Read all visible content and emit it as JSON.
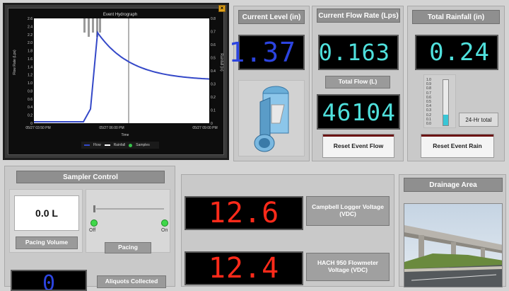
{
  "hydrograph": {
    "title": "Event Hydrograph",
    "y_left_label": "Flow Rate (Lps)",
    "y_right_label": "Rainfall (in)",
    "x_label": "Time",
    "y_left_ticks": [
      "2.6",
      "2.4",
      "2.2",
      "2.0",
      "1.8",
      "1.6",
      "1.4",
      "1.2",
      "1.0",
      "0.8",
      "0.6",
      "0.4",
      "0.2",
      "0"
    ],
    "y_right_ticks": [
      "0.8",
      "0.7",
      "0.6",
      "0.5",
      "0.4",
      "0.3",
      "0.2",
      "0.1",
      "0"
    ],
    "x_ticks": [
      "05/27 03:50 PM",
      "05/27 06:00 PM",
      "05/27 09:00 PM"
    ],
    "legend": [
      "Flow",
      "Rainfall",
      "Samples"
    ],
    "colors": {
      "flow": "#3448c8",
      "rainfall": "#ffffff",
      "samples": "#36c24a"
    },
    "close_icon": "x-icon"
  },
  "current_level": {
    "title": "Current Level (in)",
    "value": "1.37"
  },
  "current_flow": {
    "title": "Current Flow Rate (Lps)",
    "value": "0.163",
    "total_flow_label": "Total Flow (L)",
    "total_flow_value": "46104",
    "reset_label": "Reset Event Flow"
  },
  "rainfall": {
    "title": "Total Rainfall (in)",
    "value": "0.24",
    "gauge_ticks": [
      "1.0",
      "0.9",
      "0.8",
      "0.7",
      "0.6",
      "0.5",
      "0.4",
      "0.3",
      "0.2",
      "0.1",
      "0.0"
    ],
    "gauge_level": 0.24,
    "gauge_button": "24-Hr total",
    "reset_label": "Reset Event Rain"
  },
  "sampler": {
    "title": "Sampler Control",
    "pacing_volume_value": "0.0 L",
    "pacing_volume_label": "Pacing Volume",
    "switch_left": "Off",
    "switch_right": "On",
    "pacing_button": "Pacing",
    "aliquots_value": "0",
    "aliquots_label": "Aliquots Collected"
  },
  "voltages": {
    "campbell_value": "12.6",
    "campbell_label": "Campbell Logger Voltage (VDC)",
    "hach_value": "12.4",
    "hach_label": "HACH 950 Flowmeter Voltage (VDC)"
  },
  "drainage": {
    "title": "Drainage Area"
  }
}
